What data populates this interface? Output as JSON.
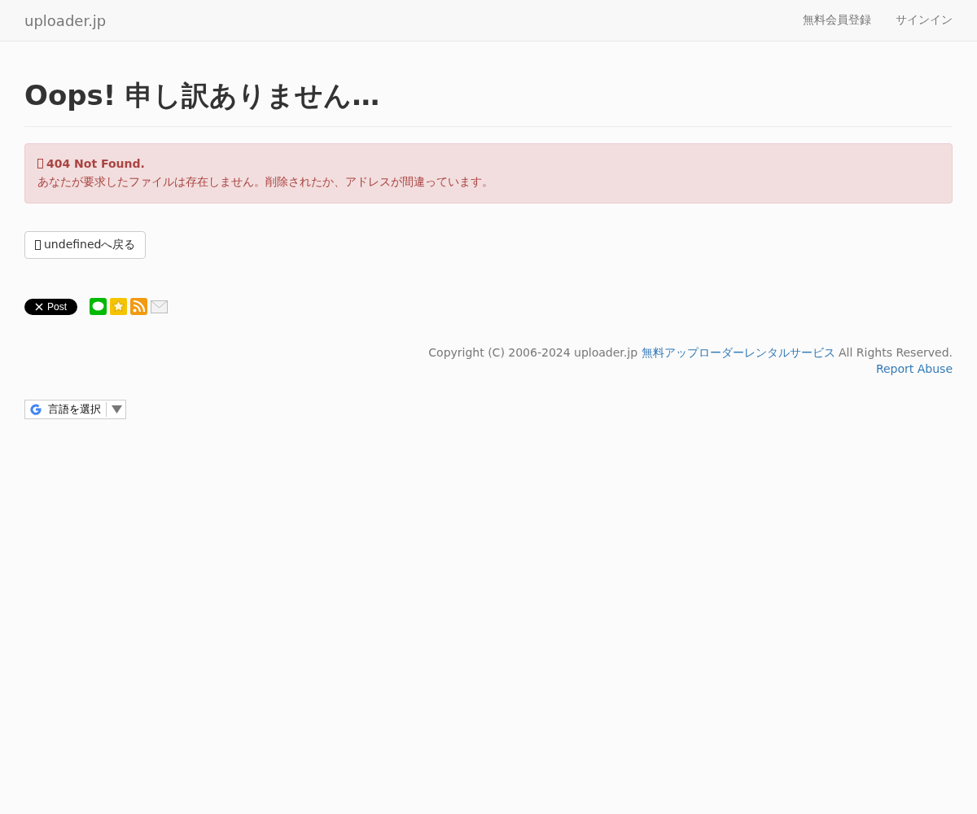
{
  "navbar": {
    "brand": "uploader.jp",
    "links": [
      "無料会員登録",
      "サインイン"
    ]
  },
  "heading": "Oops! 申し訳ありません…",
  "alert": {
    "title": "404 Not Found.",
    "message": "あなたが要求したファイルは存在しません。削除されたか、アドレスが間違っています。"
  },
  "back_button": "undefinedへ戻る",
  "share": {
    "post_button": "Post"
  },
  "footer": {
    "copyright_before": "Copyright (C) 2006-2024 uploader.jp ",
    "copyright_link": "無料アップローダーレンタルサービス",
    "copyright_after": " All Rights Reserved.",
    "report_link": "Report Abuse"
  },
  "translate": {
    "label": "言語を選択"
  }
}
